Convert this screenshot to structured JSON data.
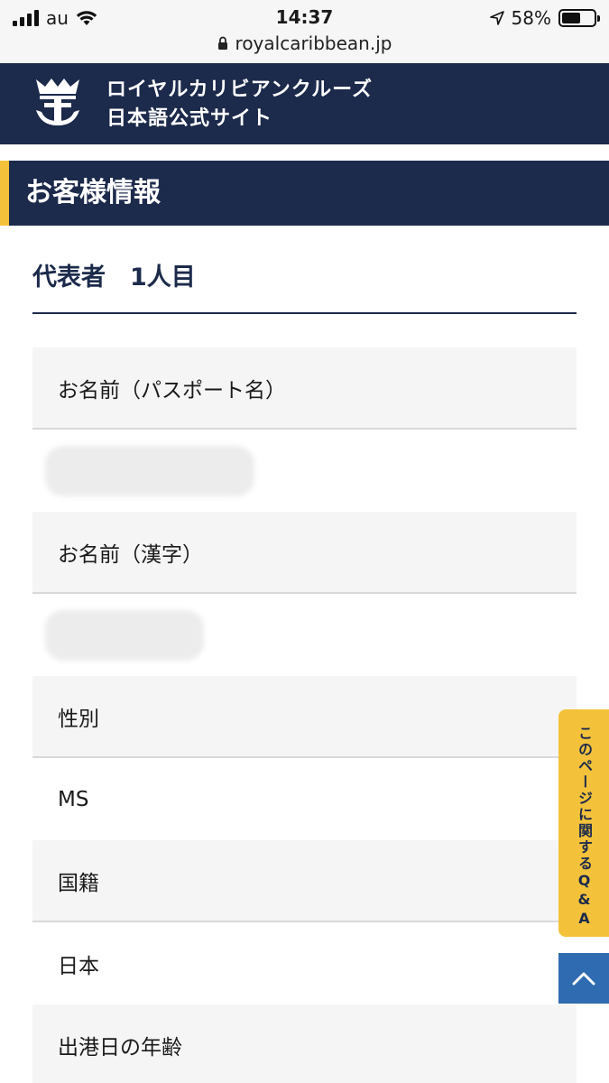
{
  "status_bar": {
    "carrier": "au",
    "time": "14:37",
    "battery": "58%",
    "battery_level": 0.58,
    "url": "royalcaribbean.jp"
  },
  "header": {
    "title_line1": "ロイヤルカリビアンクルーズ",
    "title_line2": "日本語公式サイト"
  },
  "section": {
    "title": "お客様情報"
  },
  "representative": {
    "title": "代表者　1人目"
  },
  "fields": [
    {
      "label": "お名前（パスポート名）",
      "value": ""
    },
    {
      "label": "お名前（漢字）",
      "value": ""
    },
    {
      "label": "性別",
      "value": "MS"
    },
    {
      "label": "国籍",
      "value": "日本"
    },
    {
      "label": "出港日の年齢",
      "value": ""
    }
  ],
  "floating": {
    "qa_label": "このページに関するQ&A"
  },
  "colors": {
    "navy": "#1c2a4b",
    "accent_yellow": "#f4c23a",
    "scroll_blue": "#2f6bb0"
  }
}
